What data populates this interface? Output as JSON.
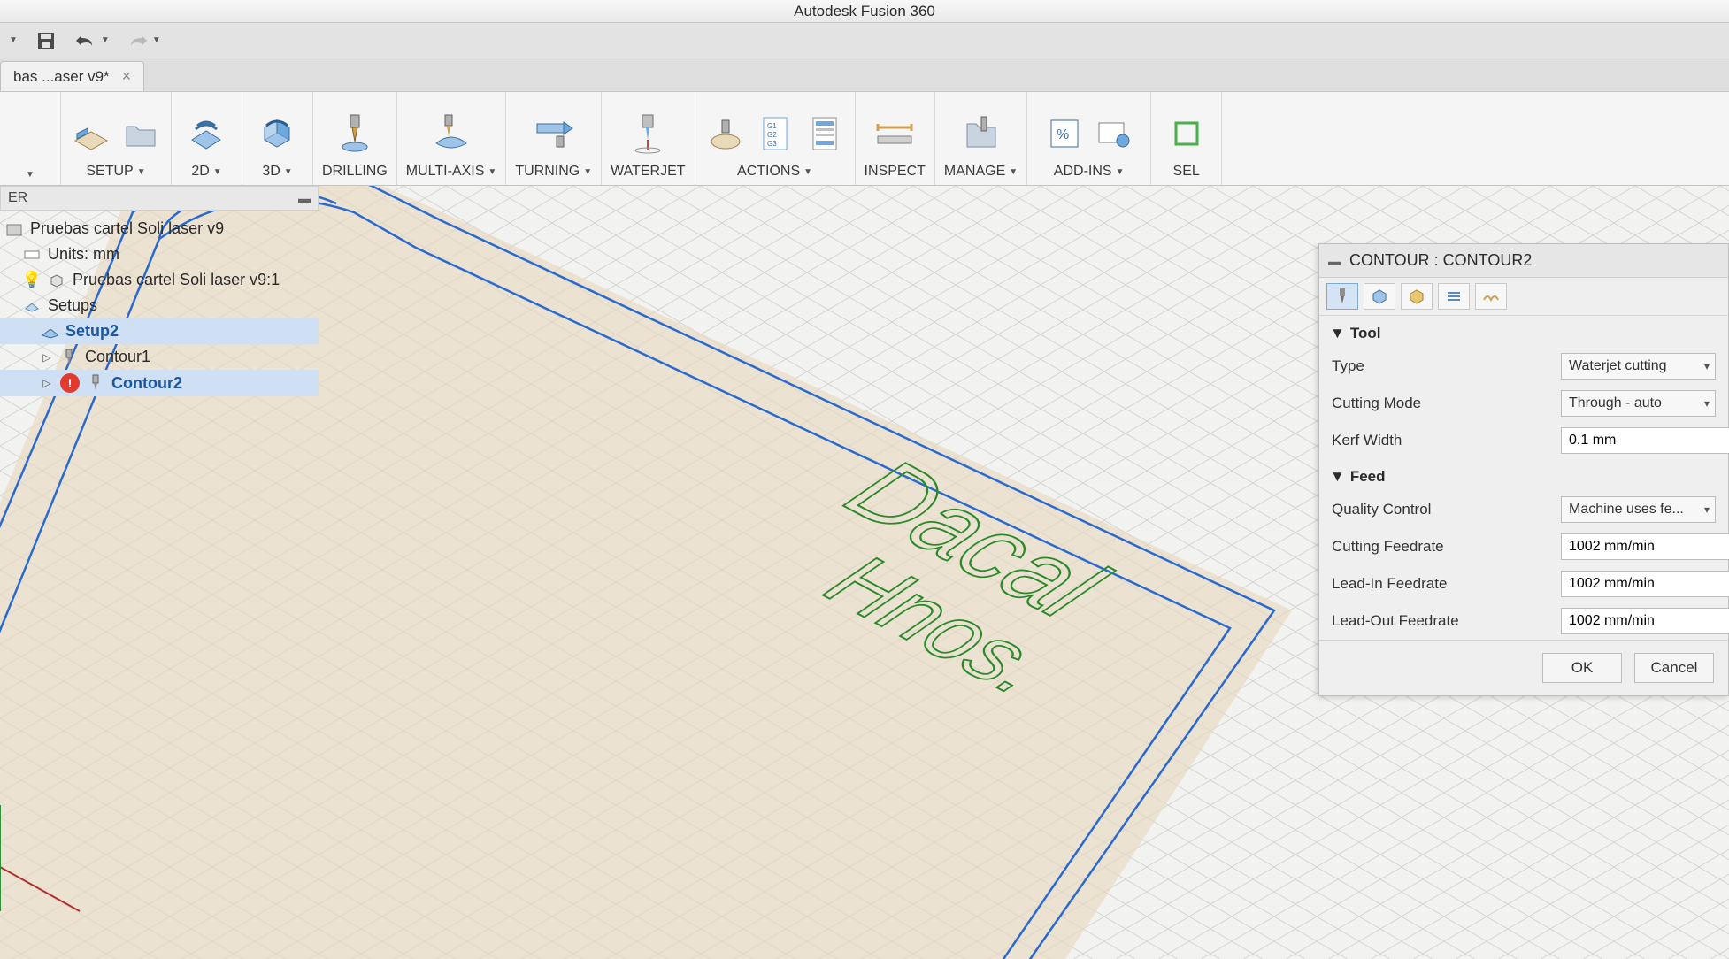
{
  "title": "Autodesk Fusion 360",
  "tab": {
    "label": "bas ...aser v9*"
  },
  "ribbon": [
    {
      "label": "",
      "caret": true
    },
    {
      "label": "SETUP",
      "caret": true
    },
    {
      "label": "2D",
      "caret": true
    },
    {
      "label": "3D",
      "caret": true
    },
    {
      "label": "DRILLING",
      "caret": false
    },
    {
      "label": "MULTI-AXIS",
      "caret": true
    },
    {
      "label": "TURNING",
      "caret": true
    },
    {
      "label": "WATERJET",
      "caret": false
    },
    {
      "label": "ACTIONS",
      "caret": true
    },
    {
      "label": "INSPECT",
      "caret": false
    },
    {
      "label": "MANAGE",
      "caret": true
    },
    {
      "label": "ADD-INS",
      "caret": true
    },
    {
      "label": "SEL",
      "caret": false
    }
  ],
  "browser": {
    "header": "ER",
    "root": "Pruebas cartel Soli laser v9",
    "units": "Units: mm",
    "component": "Pruebas cartel Soli laser v9:1",
    "setups": "Setups",
    "setup2": "Setup2",
    "contour1": "Contour1",
    "contour2": "Contour2"
  },
  "canvas_text": "Dacal Hnos.",
  "props": {
    "title": "CONTOUR : CONTOUR2",
    "sections": {
      "tool": "Tool",
      "feed": "Feed"
    },
    "tool": {
      "type_label": "Type",
      "type_value": "Waterjet cutting",
      "mode_label": "Cutting Mode",
      "mode_value": "Through - auto",
      "kerf_label": "Kerf Width",
      "kerf_value": "0.1 mm"
    },
    "feed": {
      "qc_label": "Quality Control",
      "qc_value": "Machine uses fe...",
      "cut_label": "Cutting Feedrate",
      "cut_value": "1002 mm/min",
      "leadin_label": "Lead-In Feedrate",
      "leadin_value": "1002 mm/min",
      "leadout_label": "Lead-Out Feedrate",
      "leadout_value": "1002 mm/min"
    },
    "ok": "OK",
    "cancel": "Cancel"
  }
}
